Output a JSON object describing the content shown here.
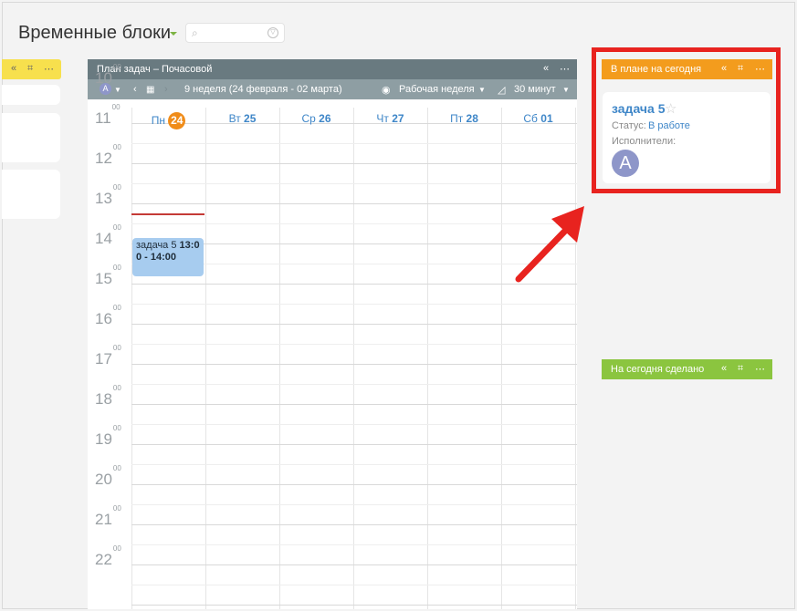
{
  "page": {
    "title": "Временные блоки"
  },
  "calendar": {
    "header_title": "План задач – Почасовой",
    "assignee_initial": "A",
    "week_label": "9 неделя (24 февраля - 02 марта)",
    "view_mode": "Рабочая неделя",
    "step": "30 минут",
    "days": [
      {
        "name": "Пн",
        "num": "24",
        "today": true
      },
      {
        "name": "Вт",
        "num": "25"
      },
      {
        "name": "Ср",
        "num": "26"
      },
      {
        "name": "Чт",
        "num": "27"
      },
      {
        "name": "Пт",
        "num": "28"
      },
      {
        "name": "Сб",
        "num": "01"
      }
    ],
    "hours": [
      "10",
      "11",
      "12",
      "13",
      "14",
      "15",
      "16",
      "17",
      "18",
      "19",
      "20",
      "21",
      "22"
    ],
    "minutes_sup": "00",
    "event": {
      "name": "задача 5",
      "time_start": "13:0",
      "time_rest": "0 - 14:00"
    }
  },
  "plan_today": {
    "header": "В плане на сегодня",
    "task": {
      "title": "задача 5",
      "status_label": "Статус:",
      "status_value": "В работе",
      "executors_label": "Исполнители:",
      "executor_initial": "A"
    }
  },
  "done_today": {
    "header": "На сегодня сделано"
  },
  "colors": {
    "calendar_header": "#697a80",
    "plan_header": "#f39c1d",
    "done_header": "#8bc53f",
    "left_header": "#f7e04d",
    "today_badge": "#f08c19",
    "event_bg": "#a7ccef",
    "highlight": "#e8231f"
  }
}
